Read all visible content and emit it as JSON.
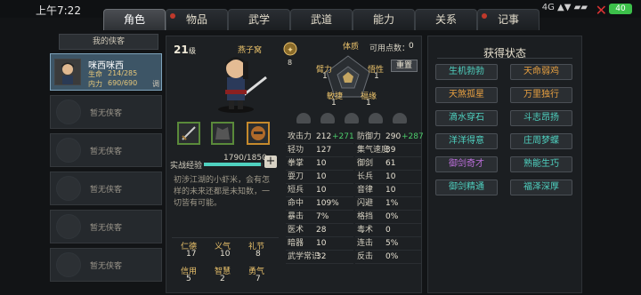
{
  "status_bar": {
    "time": "上午7:22",
    "battery": "40",
    "sys": "4G ▲▼ ▰▰"
  },
  "tabs": [
    {
      "label": "角色"
    },
    {
      "label": "物品"
    },
    {
      "label": "武学"
    },
    {
      "label": "武道"
    },
    {
      "label": "能力"
    },
    {
      "label": "关系"
    },
    {
      "label": "记事"
    }
  ],
  "left": {
    "header": "我的侠客",
    "selected": {
      "name": "咪西咪西",
      "hp_label": "生命",
      "hp": "214/285",
      "mp_label": "内力",
      "mp": "690/690",
      "tag": "调"
    },
    "empty_label": "暂无侠客"
  },
  "character": {
    "level": "21",
    "level_unit": "级",
    "location": "燕子窝",
    "coin_value": "8",
    "free_points_label": "可用点数：",
    "free_points": "0",
    "reset_label": "重置",
    "attrs": {
      "tizhi": "体质",
      "tizhi_v": "1",
      "biili": "臂力",
      "biili_v": "1",
      "wuxing": "悟性",
      "wuxing_v": "1",
      "minjie": "敏捷",
      "minjie_v": "1",
      "fuyuan": "福缘",
      "fuyuan_v": "1"
    },
    "exp_label": "实战经验",
    "exp": "1790/1850",
    "exp_fraction": 0.9676,
    "bio": "初涉江湖的小虾米，会有怎样的未来还都是未知数，一切皆有可能。",
    "virtues": [
      {
        "label": "仁德",
        "value": "17"
      },
      {
        "label": "义气",
        "value": "10"
      },
      {
        "label": "礼节",
        "value": "8"
      },
      {
        "label": "信用",
        "value": "5"
      },
      {
        "label": "智慧",
        "value": "2"
      },
      {
        "label": "勇气",
        "value": "7"
      }
    ]
  },
  "stats_left": [
    {
      "label": "攻击力",
      "value": "212",
      "bonus": "+271"
    },
    {
      "label": "轻功",
      "value": "127",
      "bonus": ""
    },
    {
      "label": "拳掌",
      "value": "10",
      "bonus": ""
    },
    {
      "label": "耍刀",
      "value": "10",
      "bonus": ""
    },
    {
      "label": "短兵",
      "value": "10",
      "bonus": ""
    },
    {
      "label": "命中",
      "value": "109%",
      "bonus": ""
    },
    {
      "label": "暴击",
      "value": "7%",
      "bonus": ""
    },
    {
      "label": "医术",
      "value": "28",
      "bonus": ""
    },
    {
      "label": "暗器",
      "value": "10",
      "bonus": ""
    },
    {
      "label": "武学常识",
      "value": "32",
      "bonus": ""
    }
  ],
  "stats_right": [
    {
      "label": "防御力",
      "value": "290",
      "bonus": "+287"
    },
    {
      "label": "集气速度",
      "value": "39",
      "bonus": ""
    },
    {
      "label": "御剑",
      "value": "61",
      "bonus": ""
    },
    {
      "label": "长兵",
      "value": "10",
      "bonus": ""
    },
    {
      "label": "音律",
      "value": "10",
      "bonus": ""
    },
    {
      "label": "闪避",
      "value": "1%",
      "bonus": ""
    },
    {
      "label": "格挡",
      "value": "0%",
      "bonus": ""
    },
    {
      "label": "毒术",
      "value": "0",
      "bonus": ""
    },
    {
      "label": "连击",
      "value": "5%",
      "bonus": ""
    },
    {
      "label": "反击",
      "value": "0%",
      "bonus": ""
    }
  ],
  "right": {
    "title": "获得状态",
    "buffs": [
      {
        "label": "生机勃勃",
        "color": "#4fd1c0"
      },
      {
        "label": "天命弱鸡",
        "color": "#e8a040"
      },
      {
        "label": "天煞孤星",
        "color": "#e8a040"
      },
      {
        "label": "万里独行",
        "color": "#e8a040"
      },
      {
        "label": "滴水穿石",
        "color": "#4fd1c0"
      },
      {
        "label": "斗志昂扬",
        "color": "#4fd1c0"
      },
      {
        "label": "洋洋得意",
        "color": "#4fd1c0"
      },
      {
        "label": "庄周梦蝶",
        "color": "#4fd1c0"
      },
      {
        "label": "御剑奇才",
        "color": "#c070e0"
      },
      {
        "label": "熟能生巧",
        "color": "#4fd1c0"
      },
      {
        "label": "御剑精通",
        "color": "#4fd1c0"
      },
      {
        "label": "福泽深厚",
        "color": "#4fd1c0"
      }
    ]
  },
  "colors": {
    "accent": "#4fd1c0",
    "gold": "#e8c06a",
    "bonus": "#4ccd6b"
  }
}
